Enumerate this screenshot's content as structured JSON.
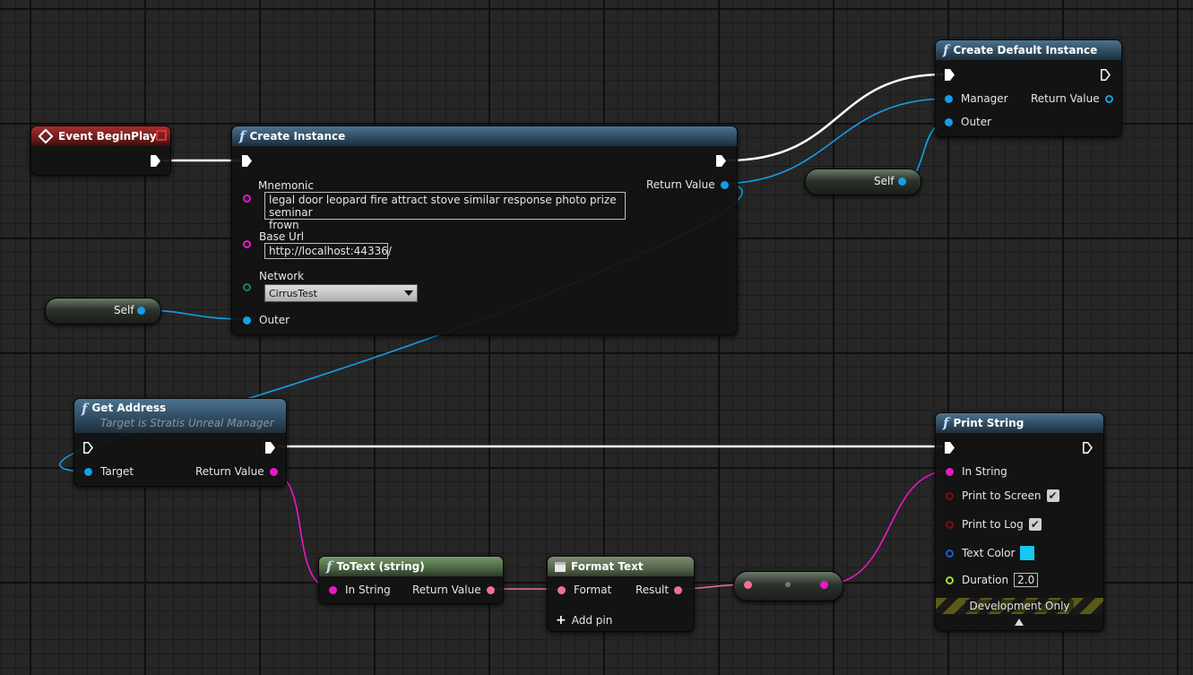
{
  "colors": {
    "exec": "#ffffff",
    "object": "#12a0e8",
    "string": "#ea18c8",
    "text": "#f06ea0",
    "color_swatch": "#14c8f0"
  },
  "nodes": {
    "event_begin_play": {
      "title": "Event BeginPlay"
    },
    "create_instance": {
      "title": "Create Instance",
      "mnemonic_label": "Mnemonic",
      "mnemonic_line1": "legal door leopard fire attract stove similar response photo prize seminar",
      "mnemonic_line2": "frown",
      "base_url_label": "Base Url",
      "base_url_value": "http://localhost:44336/",
      "network_label": "Network",
      "network_value": "CirrusTest",
      "outer_label": "Outer",
      "return_label": "Return Value"
    },
    "create_default_instance": {
      "title": "Create Default Instance",
      "manager_label": "Manager",
      "outer_label": "Outer",
      "return_label": "Return Value"
    },
    "self_top": {
      "label": "Self"
    },
    "self_left": {
      "label": "Self"
    },
    "get_address": {
      "title": "Get Address",
      "subtitle": "Target is Stratis Unreal Manager",
      "target_label": "Target",
      "return_label": "Return Value"
    },
    "to_text": {
      "title": "ToText (string)",
      "in_label": "In String",
      "return_label": "Return Value"
    },
    "format_text": {
      "title": "Format Text",
      "format_label": "Format",
      "result_label": "Result",
      "add_pin_label": "Add pin"
    },
    "print_string": {
      "title": "Print String",
      "in_string_label": "In String",
      "print_screen_label": "Print to Screen",
      "print_log_label": "Print to Log",
      "text_color_label": "Text Color",
      "duration_label": "Duration",
      "duration_value": "2.0",
      "dev_only_label": "Development Only"
    }
  }
}
